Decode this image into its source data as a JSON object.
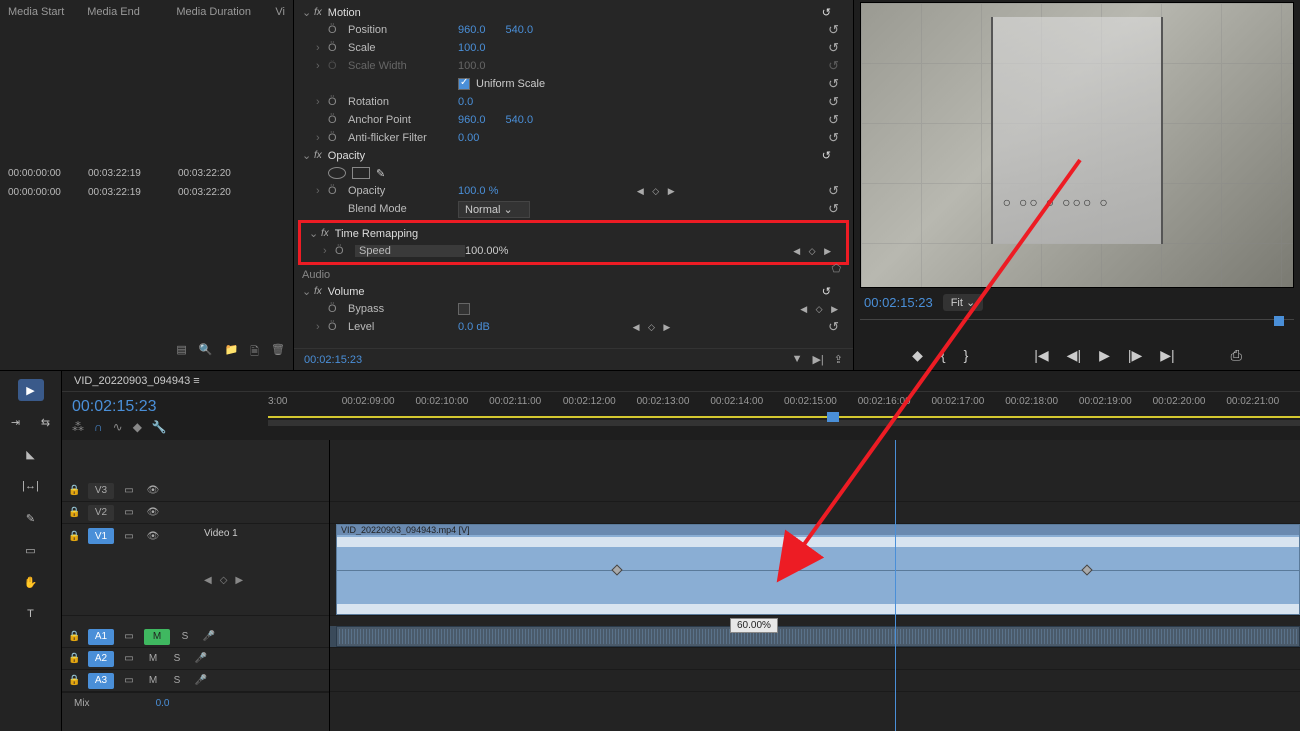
{
  "media": {
    "headers": {
      "start": "Media Start",
      "end": "Media End",
      "duration": "Media Duration",
      "vi": "Vi"
    },
    "rows": [
      {
        "start": "00:00:00:00",
        "end": "00:03:22:19",
        "duration": "00:03:22:20"
      },
      {
        "start": "00:00:00:00",
        "end": "00:03:22:19",
        "duration": "00:03:22:20"
      }
    ]
  },
  "effects": {
    "motion": {
      "title": "Motion",
      "position": {
        "label": "Position",
        "x": "960.0",
        "y": "540.0"
      },
      "scale": {
        "label": "Scale",
        "value": "100.0"
      },
      "scale_width": {
        "label": "Scale Width",
        "value": "100.0"
      },
      "uniform": {
        "label": "Uniform Scale"
      },
      "rotation": {
        "label": "Rotation",
        "value": "0.0"
      },
      "anchor": {
        "label": "Anchor Point",
        "x": "960.0",
        "y": "540.0"
      },
      "antiflicker": {
        "label": "Anti-flicker Filter",
        "value": "0.00"
      }
    },
    "opacity": {
      "title": "Opacity",
      "opacity": {
        "label": "Opacity",
        "value": "100.0 %"
      },
      "blend": {
        "label": "Blend Mode",
        "value": "Normal"
      }
    },
    "time_remap": {
      "title": "Time Remapping",
      "speed": {
        "label": "Speed",
        "value": "100.00%"
      }
    },
    "audio_section": "Audio",
    "volume": {
      "title": "Volume",
      "bypass": {
        "label": "Bypass"
      },
      "level": {
        "label": "Level",
        "value": "0.0 dB"
      }
    },
    "footer_time": "00:02:15:23"
  },
  "monitor": {
    "time": "00:02:15:23",
    "fit": "Fit"
  },
  "timeline": {
    "tab": "VID_20220903_094943  ≡",
    "time": "00:02:15:23",
    "ruler": [
      "3:00",
      "00:02:09:00",
      "00:02:10:00",
      "00:02:11:00",
      "00:02:12:00",
      "00:02:13:00",
      "00:02:14:00",
      "00:02:15:00",
      "00:02:16:00",
      "00:02:17:00",
      "00:02:18:00",
      "00:02:19:00",
      "00:02:20:00",
      "00:02:21:00"
    ],
    "tracks": {
      "v3": "V3",
      "v2": "V2",
      "v1": "V1",
      "v1_name": "Video 1",
      "a1": "A1",
      "a2": "A2",
      "a3": "A3",
      "m": "M",
      "s": "S",
      "mix": "Mix",
      "mix_val": "0.0"
    },
    "clip_name": "VID_20220903_094943.mp4 [V]",
    "speed_badge": "60.00%"
  }
}
